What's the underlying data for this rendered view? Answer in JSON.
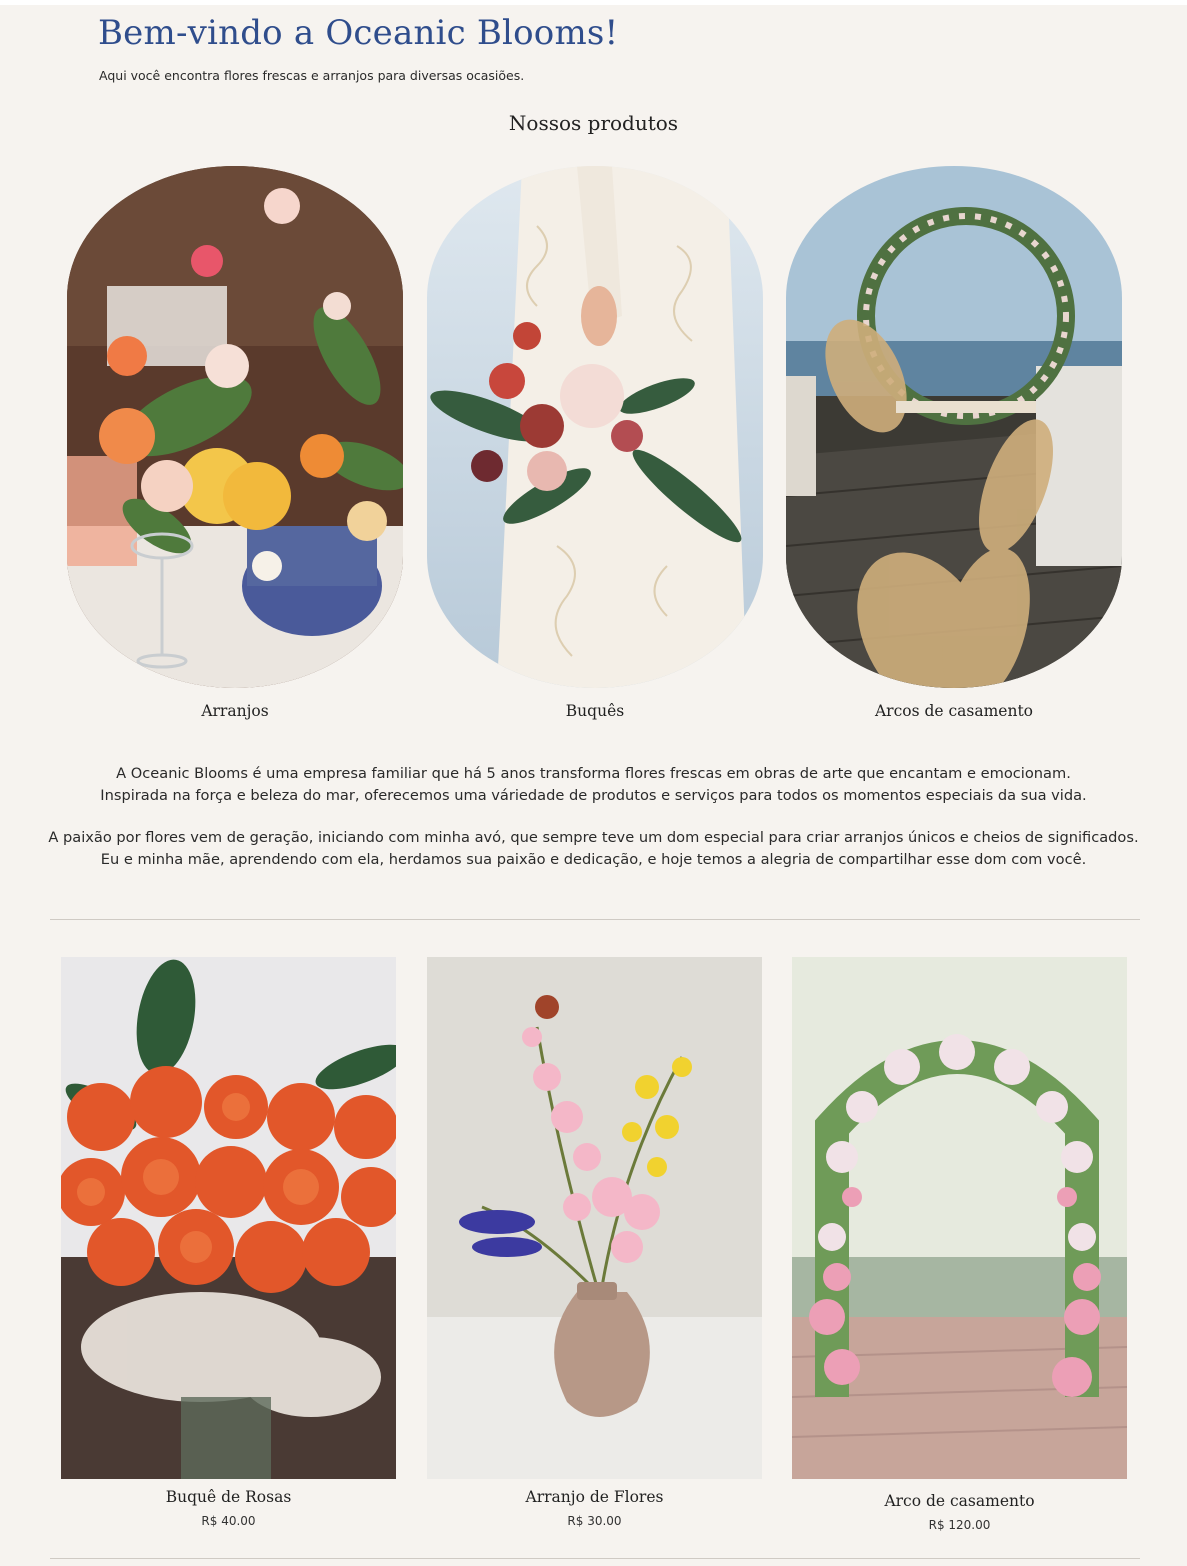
{
  "header": {
    "title": "Bem-vindo a Oceanic Blooms!",
    "subtitle": "Aqui você encontra flores frescas e arranjos para diversas ocasiões."
  },
  "products_section": {
    "heading": "Nossos produtos",
    "categories": [
      {
        "label": "Arranjos",
        "image": "table-flower-arrangement"
      },
      {
        "label": "Buquês",
        "image": "bride-holding-bouquet"
      },
      {
        "label": "Arcos de casamento",
        "image": "beach-wedding-arch"
      }
    ]
  },
  "about": {
    "p1_line1": "A Oceanic Blooms é uma empresa familiar que há 5 anos transforma flores frescas em obras de arte que encantam e emocionam.",
    "p1_line2": "Inspirada na força e beleza do mar, oferecemos uma váriedade de produtos e serviços para todos os momentos especiais da sua vida.",
    "p2_line1": "A paixão por flores vem de geração, iniciando com minha avó, que sempre teve um dom especial para criar arranjos únicos e cheios de significados.",
    "p2_line2": "Eu e minha mãe, aprendendo com ela, herdamos sua paixão e dedicação, e hoje temos a alegria de compartilhar esse dom com você."
  },
  "catalog": {
    "items": [
      {
        "name": "Buquê de Rosas",
        "price": "R$ 40.00",
        "image": "orange-roses-bouquet"
      },
      {
        "name": "Arranjo de Flores",
        "price": "R$ 30.00",
        "image": "pink-flowers-vase"
      },
      {
        "name": "Arco de casamento",
        "price": "R$ 120.00",
        "image": "garden-wedding-arch"
      }
    ]
  },
  "colors": {
    "page_background": "#f6f3ef",
    "title": "#2f4d8c",
    "divider": "#cfcac4",
    "text": "#2a2a2a"
  }
}
